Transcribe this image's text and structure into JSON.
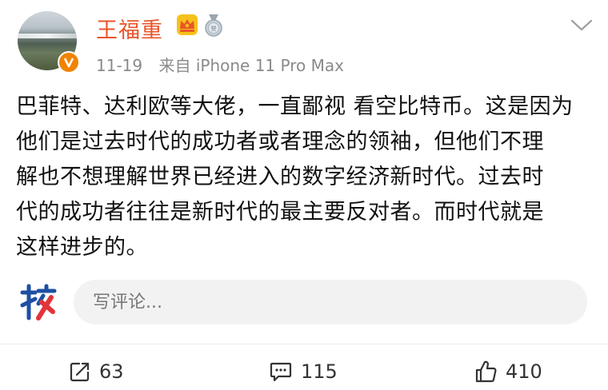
{
  "post": {
    "author": "王福重",
    "date": "11-19",
    "source": "来自 iPhone 11 Pro Max",
    "lines": [
      "巴菲特、达利欧等大佬，一直鄙视 看空比特币。这是因为",
      "他们是过去时代的成功者或者理念的领袖，但他们不理",
      "解也不想理解世界已经进入的数字经济新时代。过去时",
      "代的成功者往往是新时代的最主要反对者。而时代就是",
      "这样进步的。"
    ]
  },
  "comment": {
    "placeholder": "写评论..."
  },
  "actions": {
    "repost_count": "63",
    "comment_count": "115",
    "like_count": "410"
  },
  "colors": {
    "username": "#e8562a",
    "verify": "#f08300",
    "logo_blue": "#1e4fa3",
    "logo_red": "#e2333a"
  },
  "icons": [
    "crown-badge-icon",
    "medal-badge-icon",
    "chevron-down-icon",
    "verified-icon",
    "repost-icon",
    "comment-icon",
    "like-icon",
    "logo-he-icon"
  ]
}
